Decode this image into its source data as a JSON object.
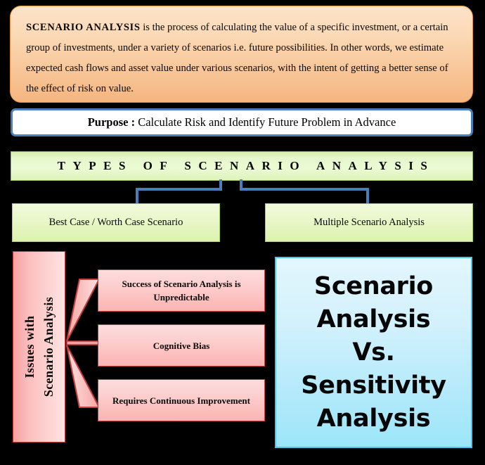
{
  "definition": {
    "term": "SCENARIO  ANALYSIS",
    "body": "  is the process of calculating the value of a specific investment, or a certain group of investments, under a variety of scenarios i.e. future possibilities. In other words, we estimate expected cash flows and asset value under various scenarios, with the intent of getting a better sense of the effect of risk on value."
  },
  "purpose": {
    "label": "Purpose :",
    "text": " Calculate Risk and Identify Future Problem in Advance"
  },
  "types_banner": {
    "title": "TYPES OF SCENARIO ANALYSIS"
  },
  "types": [
    {
      "label": "Best Case / Worth Case Scenario"
    },
    {
      "label": "Multiple Scenario Analysis"
    }
  ],
  "issues": {
    "heading_line1": "Issues with",
    "heading_line2": "Scenario Analysis",
    "items": [
      {
        "label": "Success of Scenario Analysis is Unpredictable"
      },
      {
        "label": "Cognitive Bias"
      },
      {
        "label": "Requires Continuous Improvement"
      }
    ]
  },
  "comparison": {
    "title": "Scenario\nAnalysis\nVs.\nSensitivity\nAnalysis"
  },
  "colors": {
    "background": "#000000",
    "definition_fill_top": "#fde3c9",
    "definition_fill_bottom": "#f5b57f",
    "definition_border": "#e8943e",
    "purpose_border": "#4a7ebb",
    "purpose_fill": "#ffffff",
    "banner_fill": "#eafad2",
    "banner_border": "#9ab855",
    "green_fill": "#eaf7cb",
    "green_border": "#a9cf4f",
    "pink_fill_top": "#fddddd",
    "pink_fill_bottom": "#fbb4b2",
    "pink_border": "#c1403f",
    "connector_blue": "#4a7ebb",
    "vs_fill_top": "#e3f6fd",
    "vs_fill_bottom": "#9ce6fa",
    "vs_border": "#4ec4e8",
    "text": "#0a0a0a"
  }
}
